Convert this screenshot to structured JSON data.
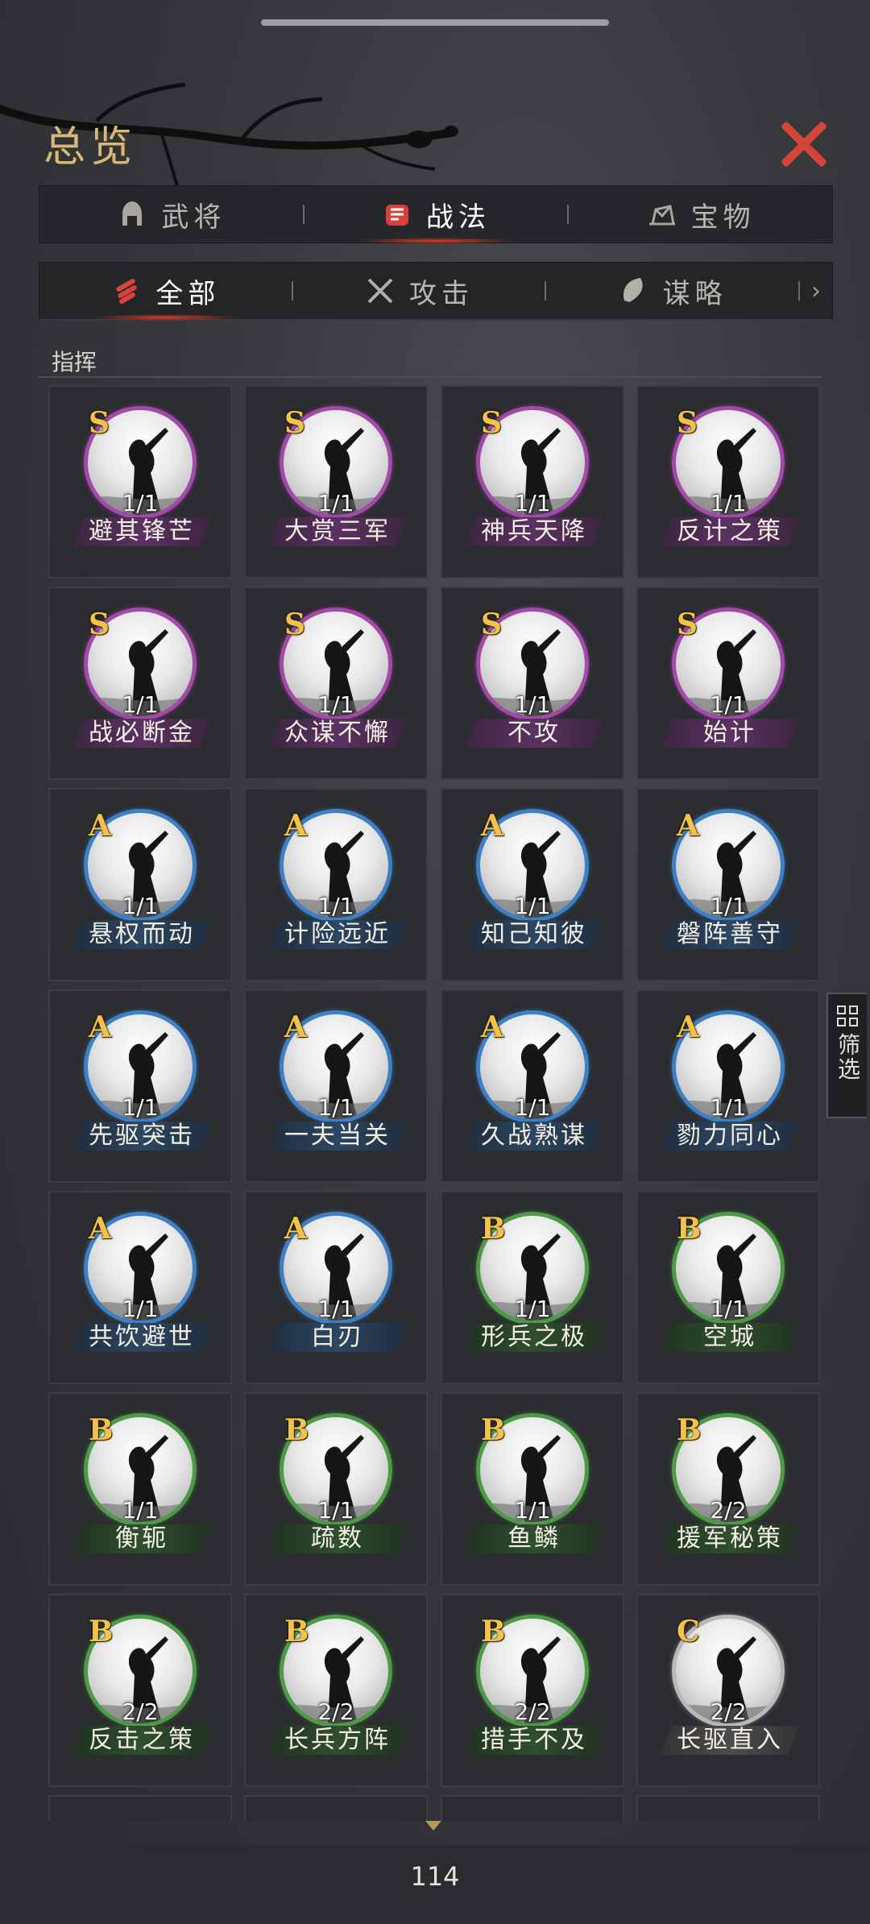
{
  "header": {
    "title": "总览"
  },
  "main_tabs": [
    {
      "label": "武将",
      "icon": "helmet-icon"
    },
    {
      "label": "战法",
      "icon": "fist-icon",
      "active": true
    },
    {
      "label": "宝物",
      "icon": "treasure-icon"
    }
  ],
  "sub_tabs": [
    {
      "label": "全部",
      "icon": "scroll-bundle-icon",
      "active": true
    },
    {
      "label": "攻击",
      "icon": "crossed-swords-icon"
    },
    {
      "label": "谋略",
      "icon": "feather-fan-icon"
    }
  ],
  "section": {
    "label": "指挥"
  },
  "skills": [
    {
      "grade": "S",
      "name": "避其锋芒",
      "count": "1/1"
    },
    {
      "grade": "S",
      "name": "大赏三军",
      "count": "1/1"
    },
    {
      "grade": "S",
      "name": "神兵天降",
      "count": "1/1"
    },
    {
      "grade": "S",
      "name": "反计之策",
      "count": "1/1"
    },
    {
      "grade": "S",
      "name": "战必断金",
      "count": "1/1"
    },
    {
      "grade": "S",
      "name": "众谋不懈",
      "count": "1/1"
    },
    {
      "grade": "S",
      "name": "不攻",
      "count": "1/1"
    },
    {
      "grade": "S",
      "name": "始计",
      "count": "1/1"
    },
    {
      "grade": "A",
      "name": "悬权而动",
      "count": "1/1"
    },
    {
      "grade": "A",
      "name": "计险远近",
      "count": "1/1"
    },
    {
      "grade": "A",
      "name": "知己知彼",
      "count": "1/1"
    },
    {
      "grade": "A",
      "name": "磐阵善守",
      "count": "1/1"
    },
    {
      "grade": "A",
      "name": "先驱突击",
      "count": "1/1"
    },
    {
      "grade": "A",
      "name": "一夫当关",
      "count": "1/1"
    },
    {
      "grade": "A",
      "name": "久战熟谋",
      "count": "1/1"
    },
    {
      "grade": "A",
      "name": "勠力同心",
      "count": "1/1"
    },
    {
      "grade": "A",
      "name": "共饮避世",
      "count": "1/1"
    },
    {
      "grade": "A",
      "name": "白刃",
      "count": "1/1"
    },
    {
      "grade": "B",
      "name": "形兵之极",
      "count": "1/1"
    },
    {
      "grade": "B",
      "name": "空城",
      "count": "1/1"
    },
    {
      "grade": "B",
      "name": "衡轭",
      "count": "1/1"
    },
    {
      "grade": "B",
      "name": "疏数",
      "count": "1/1"
    },
    {
      "grade": "B",
      "name": "鱼鳞",
      "count": "1/1"
    },
    {
      "grade": "B",
      "name": "援军秘策",
      "count": "2/2"
    },
    {
      "grade": "B",
      "name": "反击之策",
      "count": "2/2"
    },
    {
      "grade": "B",
      "name": "长兵方阵",
      "count": "2/2"
    },
    {
      "grade": "B",
      "name": "措手不及",
      "count": "2/2"
    },
    {
      "grade": "C",
      "name": "长驱直入",
      "count": "2/2"
    }
  ],
  "filter": {
    "label": "筛选"
  },
  "footer": {
    "page": "114"
  }
}
